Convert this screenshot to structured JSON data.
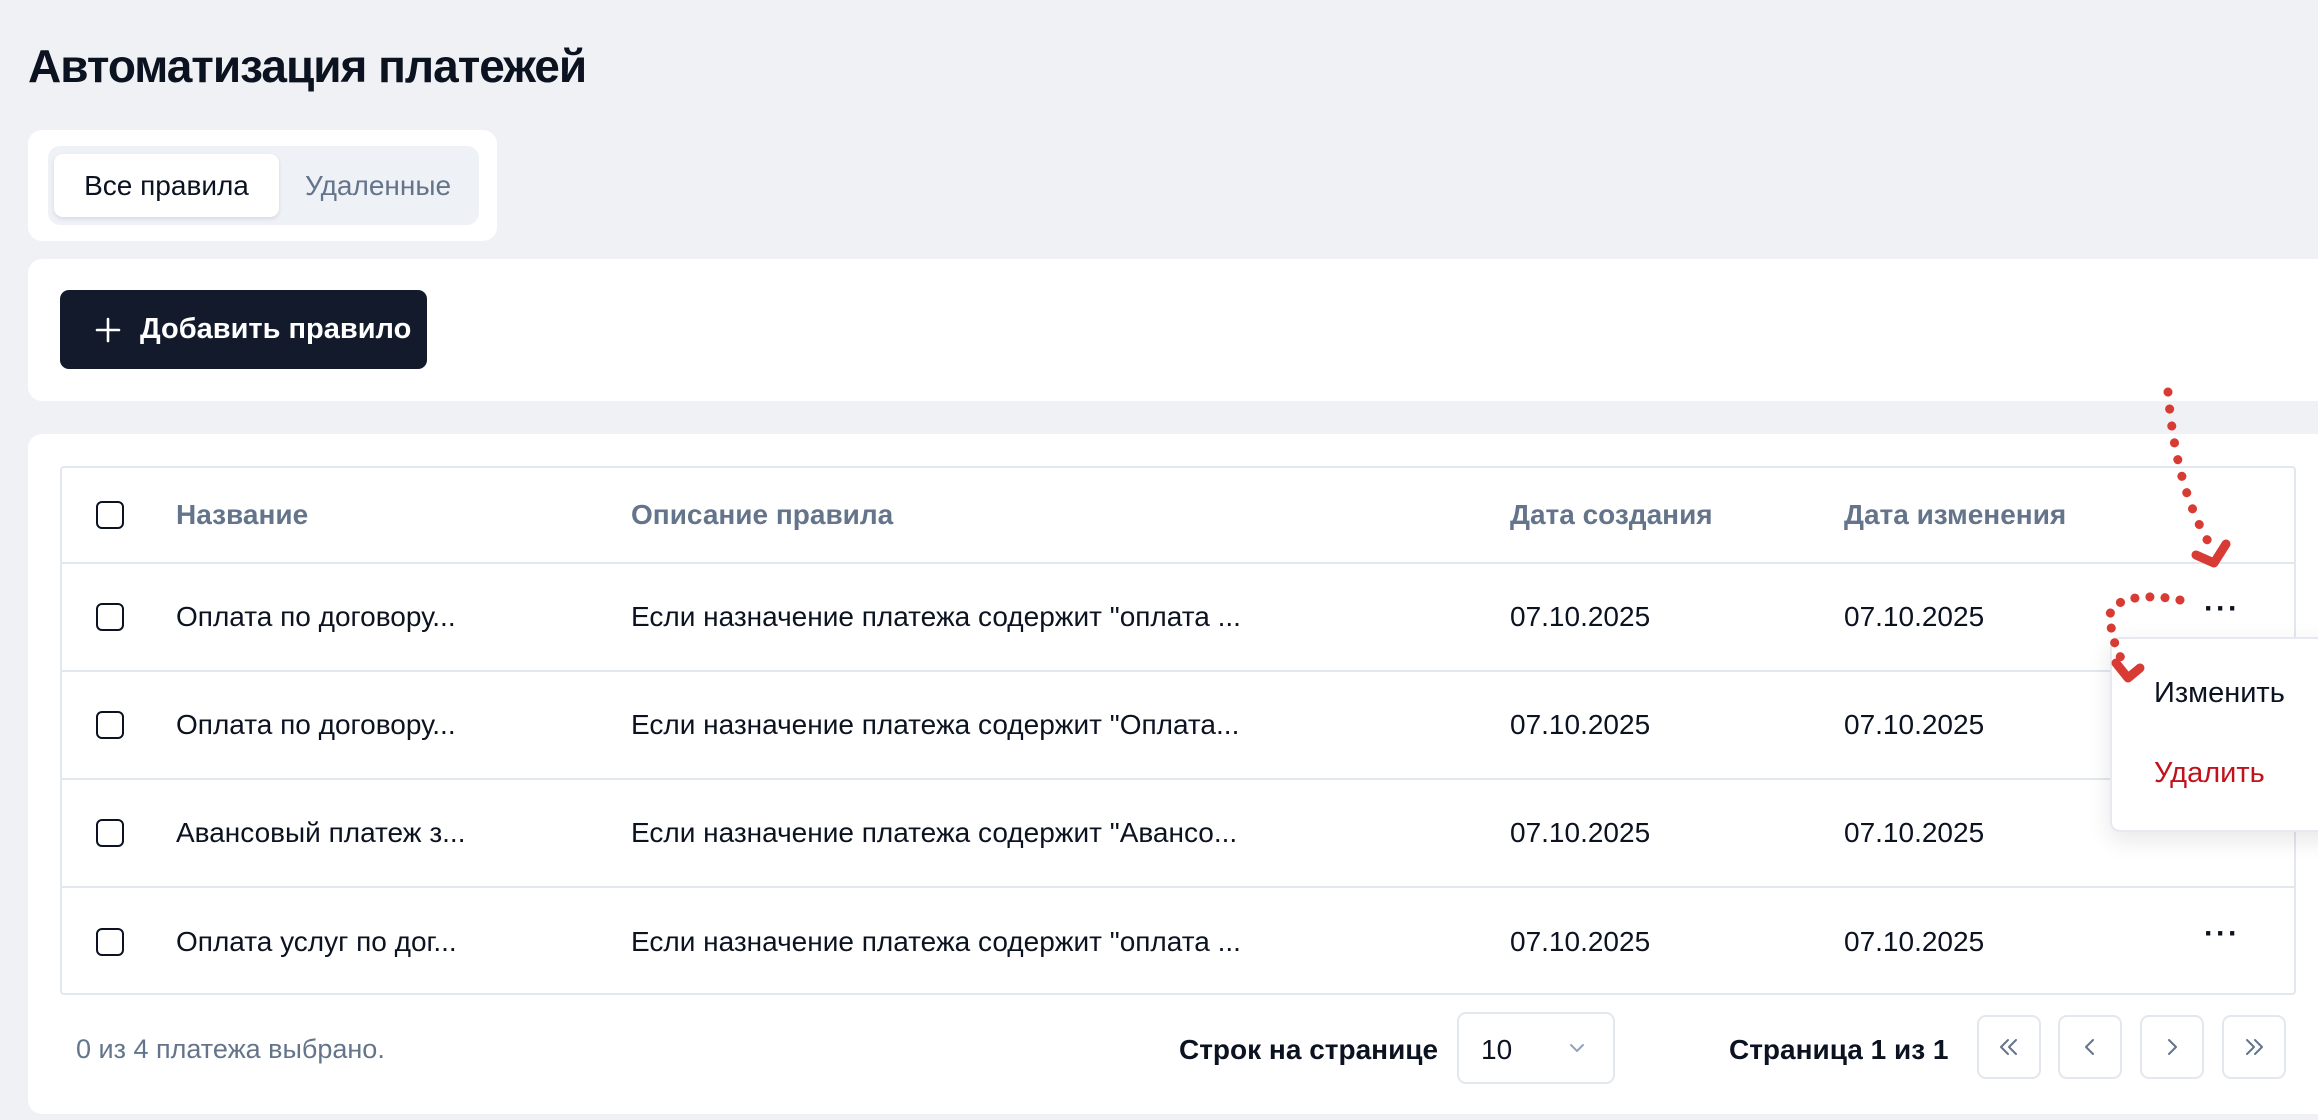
{
  "page": {
    "title": "Автоматизация платежей"
  },
  "tabs": [
    {
      "label": "Все правила",
      "active": true
    },
    {
      "label": "Удаленные",
      "active": false
    }
  ],
  "toolbar": {
    "add_label": "Добавить правило",
    "add_icon": "plus-icon"
  },
  "table": {
    "columns": [
      "Название",
      "Описание правила",
      "Дата создания",
      "Дата изменения"
    ],
    "rows": [
      {
        "name": "Оплата по договору...",
        "description": "Если назначение платежа содержит \"оплата ...",
        "created": "07.10.2025",
        "updated": "07.10.2025"
      },
      {
        "name": "Оплата по договору...",
        "description": "Если назначение платежа содержит \"Оплата...",
        "created": "07.10.2025",
        "updated": "07.10.2025"
      },
      {
        "name": "Авансовый платеж з...",
        "description": "Если назначение платежа содержит \"Авансо...",
        "created": "07.10.2025",
        "updated": "07.10.2025"
      },
      {
        "name": "Оплата услуг по дог...",
        "description": "Если назначение платежа содержит \"оплата ...",
        "created": "07.10.2025",
        "updated": "07.10.2025"
      }
    ],
    "row_actions_glyph": "···"
  },
  "context_menu": {
    "edit_label": "Изменить",
    "delete_label": "Удалить",
    "delete_color": "#c0121a"
  },
  "footer": {
    "selected_text": "0 из 4 платежа выбрано.",
    "rows_per_page_label": "Строк на странице",
    "rows_per_page_value": "10",
    "page_text": "Страница 1 из 1"
  },
  "colors": {
    "primary_button": "#121a2c",
    "background": "#f0f1f5",
    "muted_text": "#64748b",
    "annotation_arrow": "#d83a34"
  }
}
